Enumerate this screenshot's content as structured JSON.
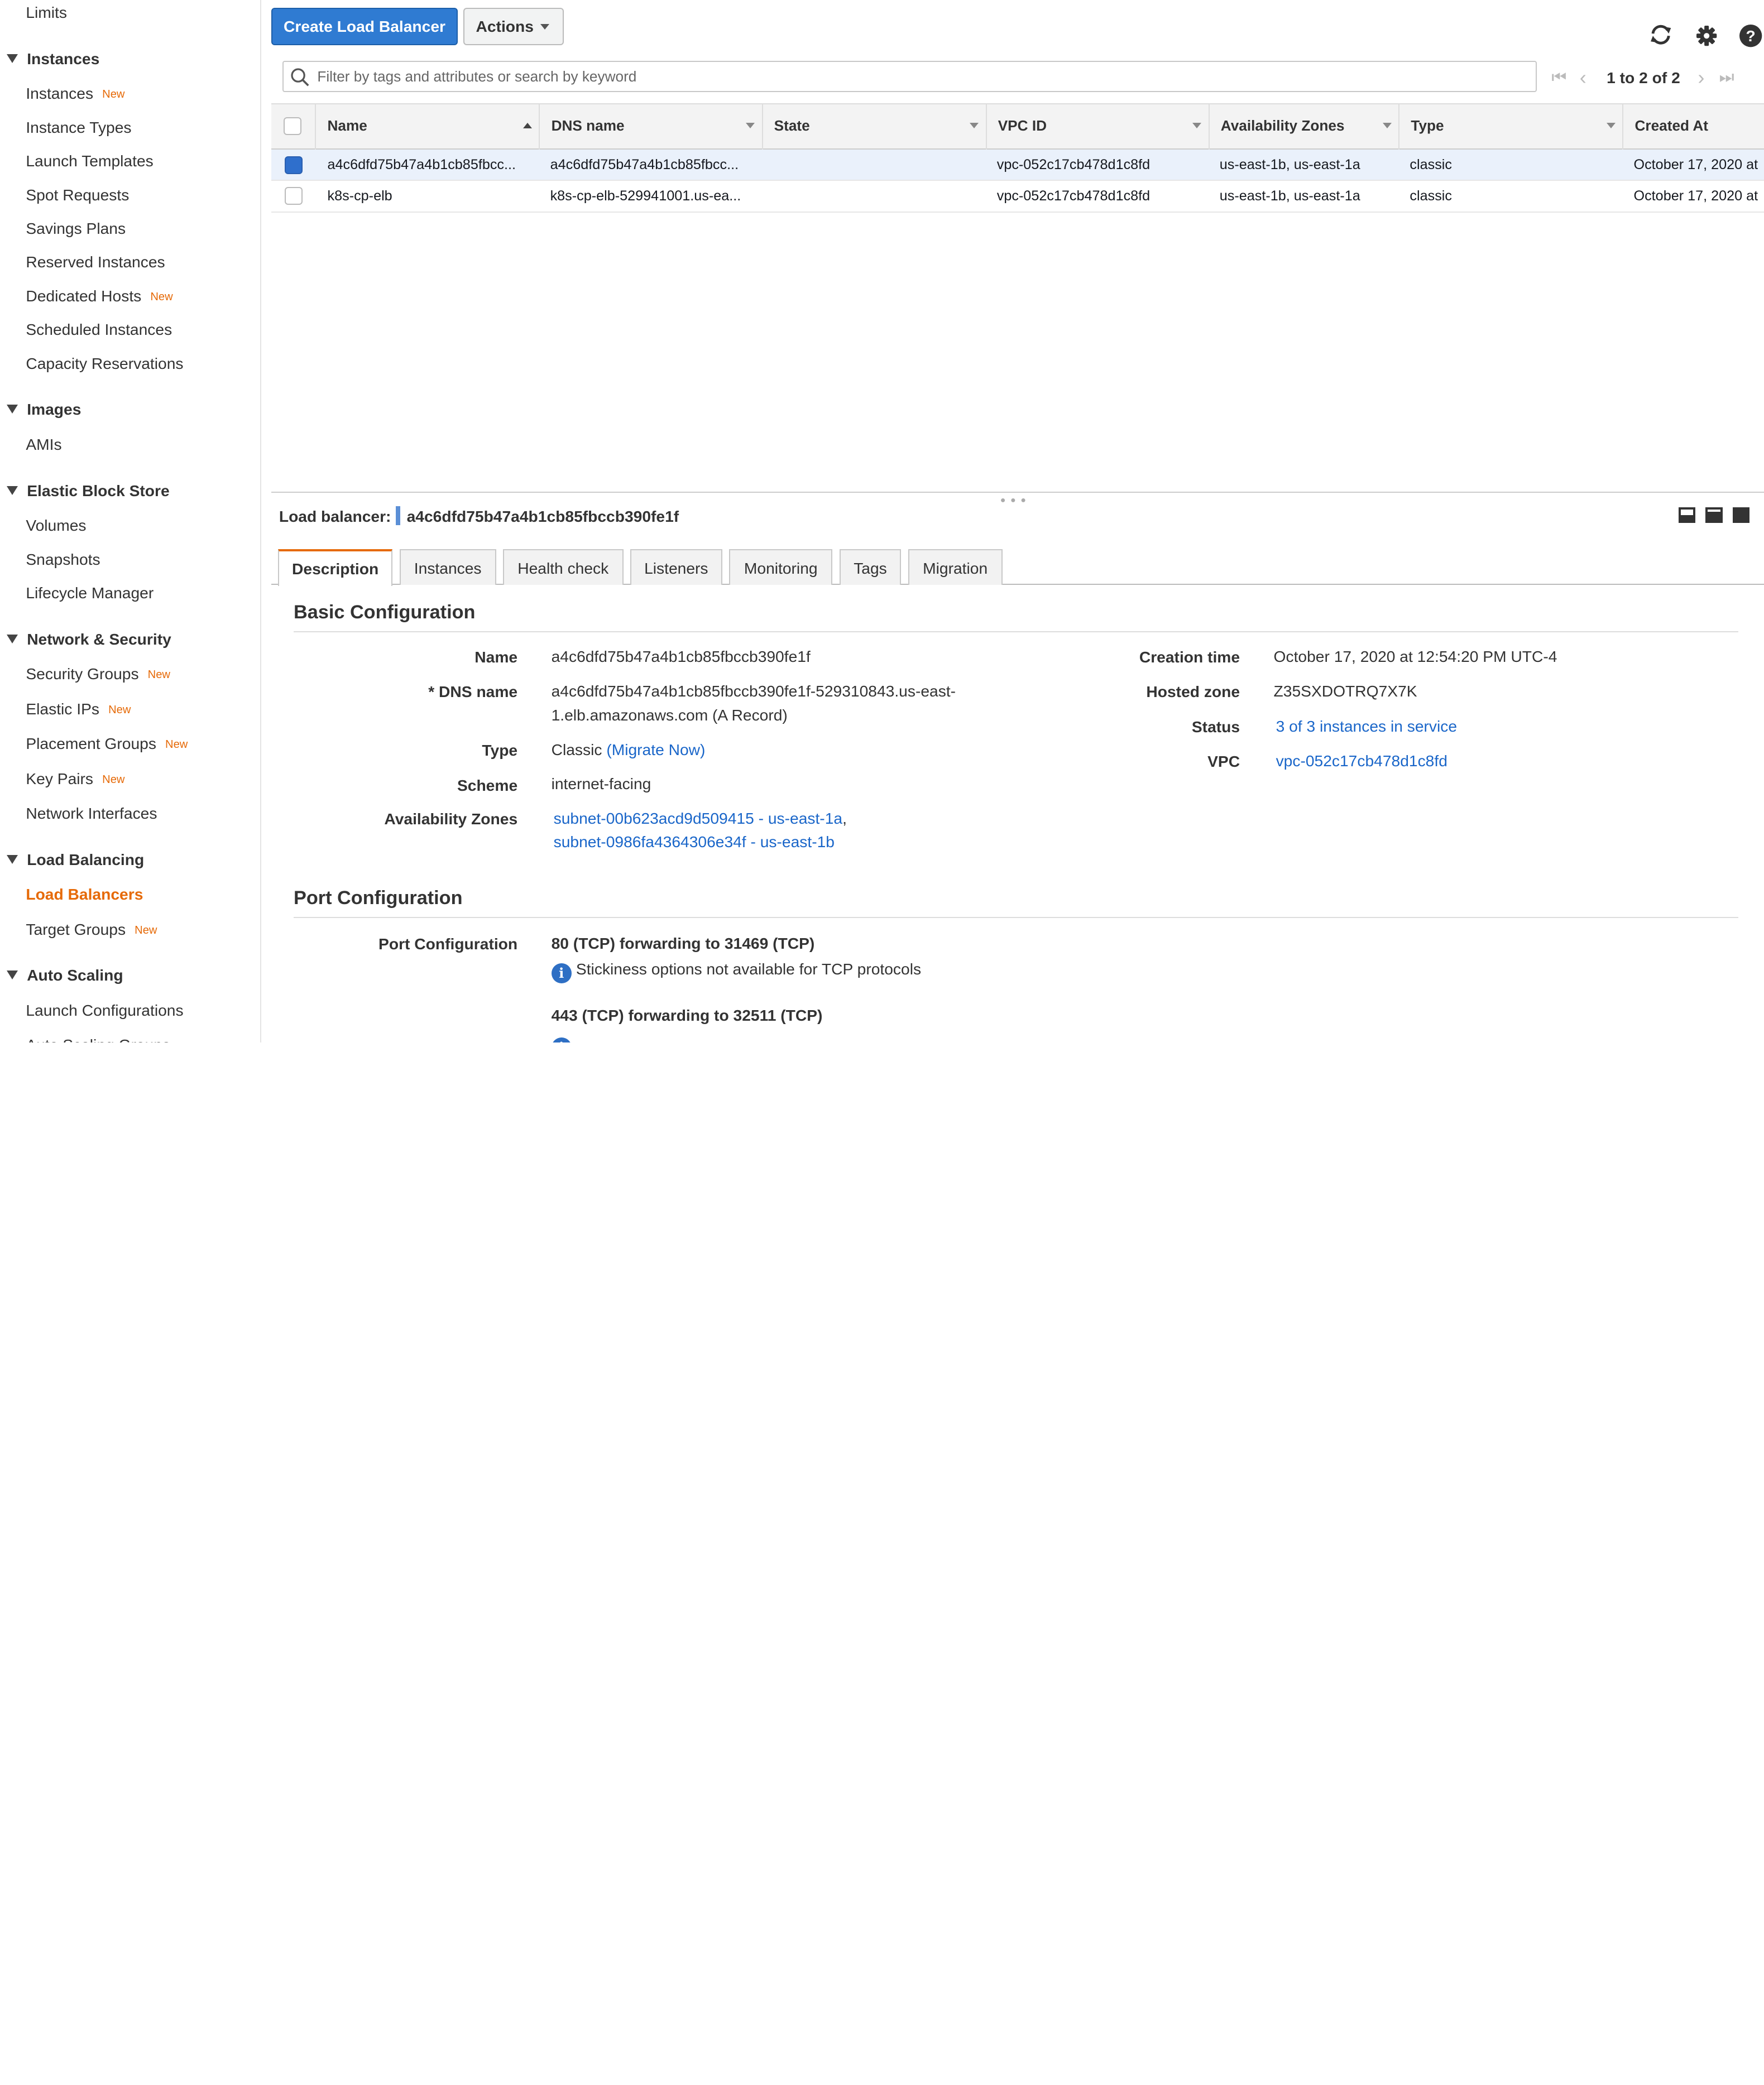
{
  "sidebar": {
    "items": [
      {
        "label": "Limits",
        "type": "item"
      },
      {
        "label": "Instances",
        "type": "header"
      },
      {
        "label": "Instances",
        "type": "item",
        "badge": "New"
      },
      {
        "label": "Instance Types",
        "type": "item"
      },
      {
        "label": "Launch Templates",
        "type": "item"
      },
      {
        "label": "Spot Requests",
        "type": "item"
      },
      {
        "label": "Savings Plans",
        "type": "item"
      },
      {
        "label": "Reserved Instances",
        "type": "item"
      },
      {
        "label": "Dedicated Hosts",
        "type": "item",
        "badge": "New"
      },
      {
        "label": "Scheduled Instances",
        "type": "item"
      },
      {
        "label": "Capacity Reservations",
        "type": "item"
      },
      {
        "label": "Images",
        "type": "header"
      },
      {
        "label": "AMIs",
        "type": "item"
      },
      {
        "label": "Elastic Block Store",
        "type": "header"
      },
      {
        "label": "Volumes",
        "type": "item"
      },
      {
        "label": "Snapshots",
        "type": "item"
      },
      {
        "label": "Lifecycle Manager",
        "type": "item"
      },
      {
        "label": "Network & Security",
        "type": "header"
      },
      {
        "label": "Security Groups",
        "type": "item",
        "badge": "New"
      },
      {
        "label": "Elastic IPs",
        "type": "item",
        "badge": "New"
      },
      {
        "label": "Placement Groups",
        "type": "item",
        "badge": "New"
      },
      {
        "label": "Key Pairs",
        "type": "item",
        "badge": "New"
      },
      {
        "label": "Network Interfaces",
        "type": "item"
      },
      {
        "label": "Load Balancing",
        "type": "header"
      },
      {
        "label": "Load Balancers",
        "type": "item",
        "active": true
      },
      {
        "label": "Target Groups",
        "type": "item",
        "badge": "New"
      },
      {
        "label": "Auto Scaling",
        "type": "header"
      },
      {
        "label": "Launch Configurations",
        "type": "item"
      },
      {
        "label": "Auto Scaling Groups",
        "type": "item"
      }
    ]
  },
  "toolbar": {
    "create_label": "Create Load Balancer",
    "actions_label": "Actions",
    "icons": [
      "refresh-icon",
      "gear-icon",
      "help-icon"
    ]
  },
  "filter": {
    "placeholder": "Filter by tags and attributes or search by keyword"
  },
  "pager": {
    "text": "1 to 2 of 2"
  },
  "table": {
    "columns": [
      "Name",
      "DNS name",
      "State",
      "VPC ID",
      "Availability Zones",
      "Type",
      "Created At"
    ],
    "rows": [
      {
        "selected": true,
        "name": "a4c6dfd75b47a4b1cb85fbcc...",
        "dns": "a4c6dfd75b47a4b1cb85fbcc...",
        "state": "",
        "vpc": "vpc-052c17cb478d1c8fd",
        "azs": "us-east-1b, us-east-1a",
        "type": "classic",
        "created": "October 17, 2020 at"
      },
      {
        "selected": false,
        "name": "k8s-cp-elb",
        "dns": "k8s-cp-elb-529941001.us-ea...",
        "state": "",
        "vpc": "vpc-052c17cb478d1c8fd",
        "azs": "us-east-1b, us-east-1a",
        "type": "classic",
        "created": "October 17, 2020 at"
      }
    ]
  },
  "details": {
    "label": "Load balancer:",
    "lb_name": "a4c6dfd75b47a4b1cb85fbccb390fe1f",
    "tabs": [
      "Description",
      "Instances",
      "Health check",
      "Listeners",
      "Monitoring",
      "Tags",
      "Migration"
    ],
    "basic": {
      "title": "Basic Configuration",
      "name_label": "Name",
      "name_value": "a4c6dfd75b47a4b1cb85fbccb390fe1f",
      "dns_label": "* DNS name",
      "dns_value_1": "a4c6dfd75b47a4b1cb85fbccb390fe1f-529310843.us-east-",
      "dns_value_2": "1.elb.amazonaws.com (A Record)",
      "type_label": "Type",
      "type_value": "Classic",
      "type_link": "(Migrate Now)",
      "scheme_label": "Scheme",
      "scheme_value": "internet-facing",
      "az_label": "Availability Zones",
      "az_1": "subnet-00b623acd9d509415 - us-east-1a",
      "az_1_suffix": ",",
      "az_2": "subnet-0986fa4364306e34f - us-east-1b",
      "creation_label": "Creation time",
      "creation_value": "October 17, 2020 at 12:54:20 PM UTC-4",
      "hosted_label": "Hosted zone",
      "hosted_value": "Z35SXDOTRQ7X7K",
      "status_label": "Status",
      "status_value": "3 of 3 instances in service",
      "vpc_label": "VPC",
      "vpc_value": "vpc-052c17cb478d1c8fd"
    },
    "port": {
      "title": "Port Configuration",
      "label": "Port Configuration",
      "rule_1": "80 (TCP) forwarding to 31469 (TCP)",
      "note_1": "Stickiness options not available for TCP protocols",
      "rule_2": "443 (TCP) forwarding to 32511 (TCP)"
    }
  },
  "colors": {
    "accent_orange": "#e66a08",
    "primary_blue": "#2f7bd2",
    "link_blue": "#1a66c9"
  }
}
